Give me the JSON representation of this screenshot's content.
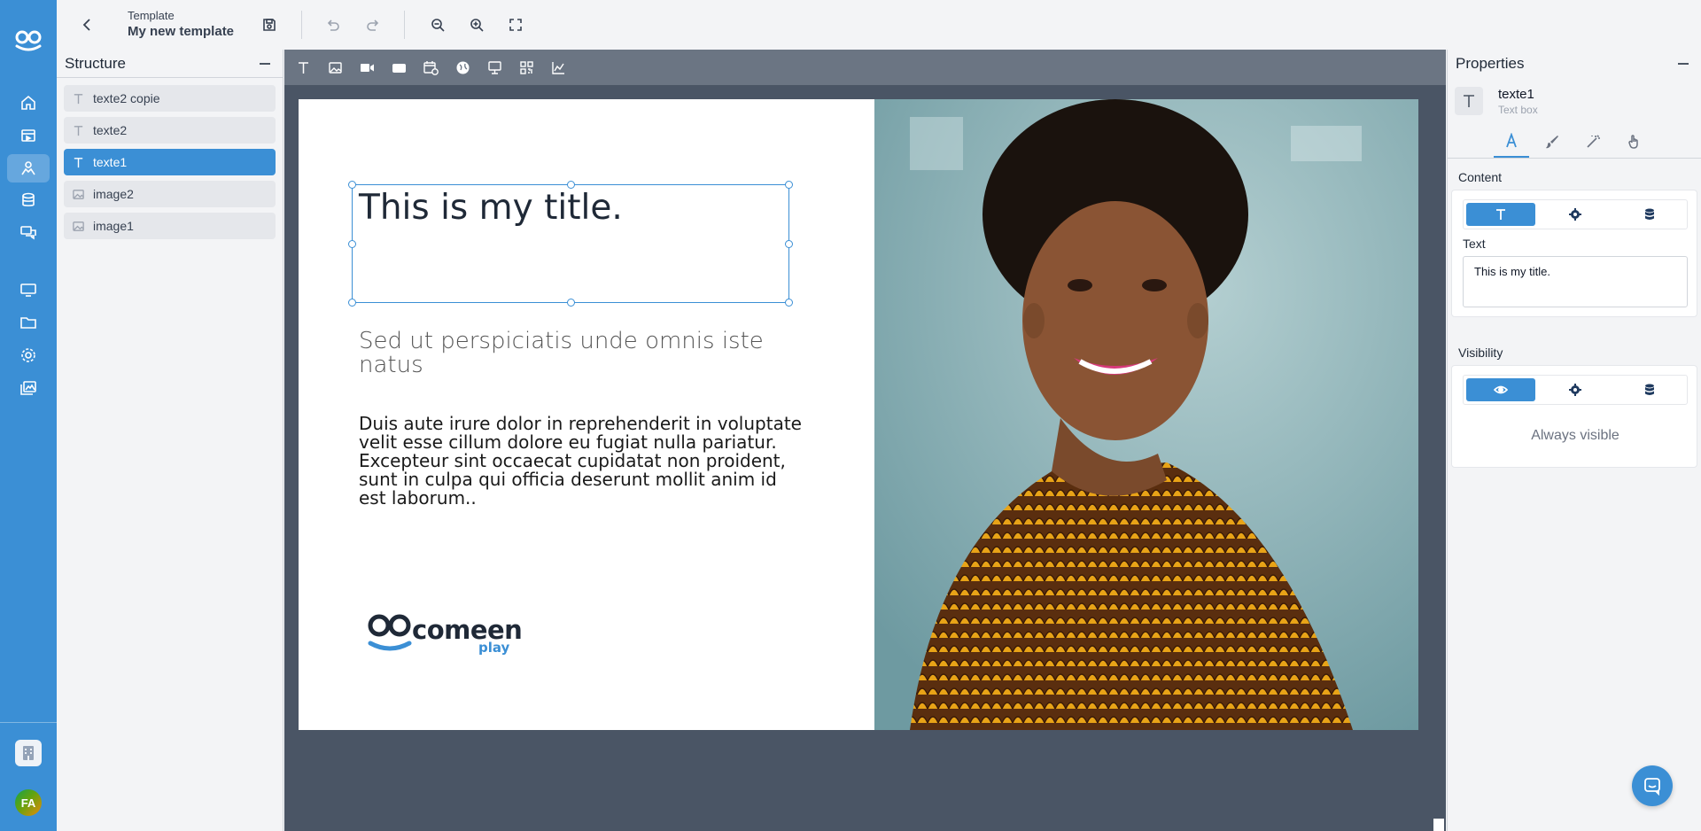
{
  "colors": {
    "accent": "#3b8fd5",
    "canvas_bg": "#4a5565",
    "widget_bar": "#6b7583"
  },
  "nav": {
    "items": [
      "home-icon",
      "media-icon",
      "templates-icon",
      "database-icon",
      "chat-icon",
      "screens-icon",
      "folder-icon",
      "settings-icon",
      "gallery-icon"
    ],
    "active": "templates-icon",
    "avatar_initials": "FA"
  },
  "topbar": {
    "breadcrumb": "Template",
    "title": "My new template"
  },
  "structure": {
    "title": "Structure",
    "layers": [
      {
        "label": "texte2 copie",
        "kind": "text",
        "selected": false
      },
      {
        "label": "texte2",
        "kind": "text",
        "selected": false
      },
      {
        "label": "texte1",
        "kind": "text",
        "selected": true
      },
      {
        "label": "image2",
        "kind": "image",
        "selected": false
      },
      {
        "label": "image1",
        "kind": "image",
        "selected": false
      }
    ]
  },
  "widgets": [
    "text-widget-icon",
    "image-widget-icon",
    "video-widget-icon",
    "shape-widget-icon",
    "calendar-widget-icon",
    "web-widget-icon",
    "presentation-widget-icon",
    "qrcode-widget-icon",
    "chart-widget-icon"
  ],
  "canvas": {
    "title": "This is my title.",
    "subtitle": "Sed ut perspiciatis unde omnis iste natus",
    "body": " Duis aute irure dolor in reprehenderit in voluptate velit esse cillum dolore eu fugiat nulla pariatur. Excepteur sint occaecat cupidatat non proident, sunt in culpa qui officia deserunt mollit anim id est laborum..",
    "logo_text": "comeen",
    "logo_subtext": "play"
  },
  "properties": {
    "title": "Properties",
    "element_name": "texte1",
    "element_type": "Text box",
    "content_label": "Content",
    "text_label": "Text",
    "text_value": "This is my title.",
    "visibility_label": "Visibility",
    "visibility_value": "Always visible"
  }
}
